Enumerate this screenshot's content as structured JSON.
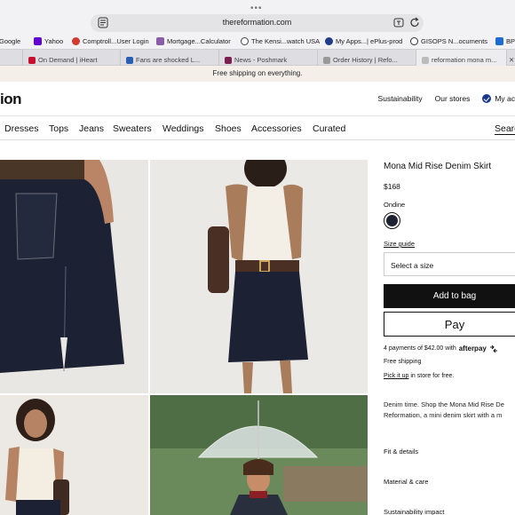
{
  "browser": {
    "url": "thereformation.com",
    "bookmarks": [
      {
        "label": "Google",
        "color": "#4285f4"
      },
      {
        "label": "Yahoo",
        "color": "#6001d2"
      },
      {
        "label": "Comptroll...User Login",
        "color": "#d23b2f"
      },
      {
        "label": "Mortgage...Calculator",
        "color": "#8b5ca8"
      },
      {
        "label": "The Kensi...watch USA",
        "color": "#444"
      },
      {
        "label": "My Apps...| ePlus-prod",
        "color": "#1f3b8a"
      },
      {
        "label": "GISOPS N...ocuments",
        "color": "#333"
      },
      {
        "label": "BP&",
        "color": "#1c6bd1"
      }
    ],
    "tabs": [
      {
        "label": "On Demand | iHeart",
        "color": "#c6102e"
      },
      {
        "label": "Fans are shocked L...",
        "color": "#2b5fb3"
      },
      {
        "label": "News - Poshmark",
        "color": "#7b1f4f"
      },
      {
        "label": "Order History | Refo...",
        "color": "#999"
      },
      {
        "label": "reformation mona m...",
        "color": "#bbb"
      }
    ]
  },
  "site": {
    "promo": "Free shipping on everything.",
    "logo": "ion",
    "header_links": {
      "sustainability": "Sustainability",
      "stores": "Our stores",
      "account": "My ac"
    },
    "categories": [
      "Dresses",
      "Tops",
      "Jeans",
      "Sweaters",
      "Weddings",
      "Shoes",
      "Accessories",
      "Curated"
    ],
    "search": "Searc"
  },
  "product": {
    "title": "Mona Mid Rise Denim Skirt",
    "price": "$168",
    "color_name": "Ondine",
    "swatch_color": "#1e2230",
    "size_guide": "Size guide",
    "select_size": "Select a size",
    "add_to_bag": "Add to bag",
    "apple_pay": "Pay",
    "afterpay_text": "4 payments of $42.00 with",
    "afterpay_brand": "afterpay",
    "shipping": "Free shipping",
    "pickup_link": "Pick it up",
    "pickup_rest": " in store for free.",
    "description": "Denim time. Shop the Mona Mid Rise De Reformation, a mini denim skirt with a m",
    "accordions": [
      "Fit & details",
      "Material & care",
      "Sustainability impact"
    ]
  }
}
